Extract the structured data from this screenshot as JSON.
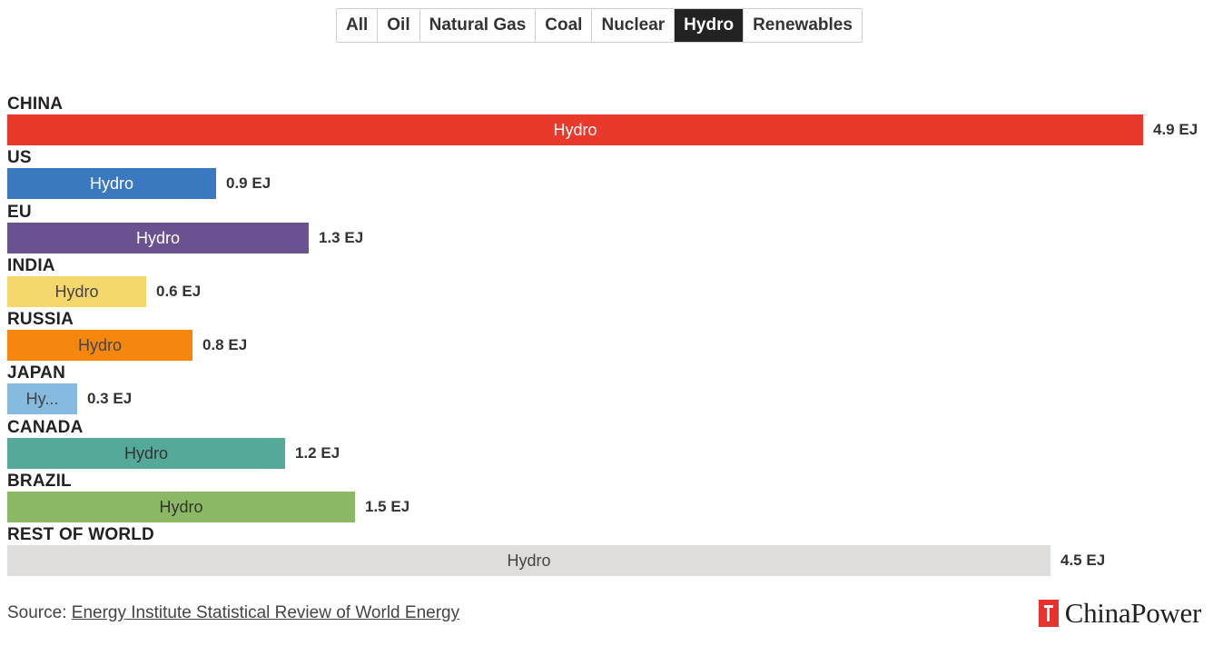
{
  "tabs": [
    {
      "label": "All",
      "active": false
    },
    {
      "label": "Oil",
      "active": false
    },
    {
      "label": "Natural Gas",
      "active": false
    },
    {
      "label": "Coal",
      "active": false
    },
    {
      "label": "Nuclear",
      "active": false
    },
    {
      "label": "Hydro",
      "active": true
    },
    {
      "label": "Renewables",
      "active": false
    }
  ],
  "chart_data": {
    "type": "bar",
    "orientation": "horizontal",
    "unit": "EJ",
    "xlim": [
      0,
      4.9
    ],
    "grid": false,
    "categories": [
      "CHINA",
      "US",
      "EU",
      "INDIA",
      "RUSSIA",
      "JAPAN",
      "CANADA",
      "BRAZIL",
      "REST OF WORLD"
    ],
    "segment_label": "Hydro",
    "values": [
      4.9,
      0.9,
      1.3,
      0.6,
      0.8,
      0.3,
      1.2,
      1.5,
      4.5
    ],
    "value_labels": [
      "4.9 EJ",
      "0.9 EJ",
      "1.3 EJ",
      "0.6 EJ",
      "0.8 EJ",
      "0.3 EJ",
      "1.2 EJ",
      "1.5 EJ",
      "4.5 EJ"
    ],
    "segment_labels": [
      "Hydro",
      "Hydro",
      "Hydro",
      "Hydro",
      "Hydro",
      "Hy...",
      "Hydro",
      "Hydro",
      "Hydro"
    ],
    "colors": [
      "#e8392b",
      "#3a78bf",
      "#6a518f",
      "#f6d76b",
      "#f5870f",
      "#86bade",
      "#55a999",
      "#8bb864",
      "#dedddb"
    ],
    "text_colors": [
      "#ffffff",
      "#ffffff",
      "#ffffff",
      "#444444",
      "#444444",
      "#444444",
      "#333333",
      "#333333",
      "#444444"
    ]
  },
  "footer": {
    "source_prefix": "Source: ",
    "source_link": "Energy Institute Statistical Review of World Energy",
    "brand": "ChinaPower"
  }
}
